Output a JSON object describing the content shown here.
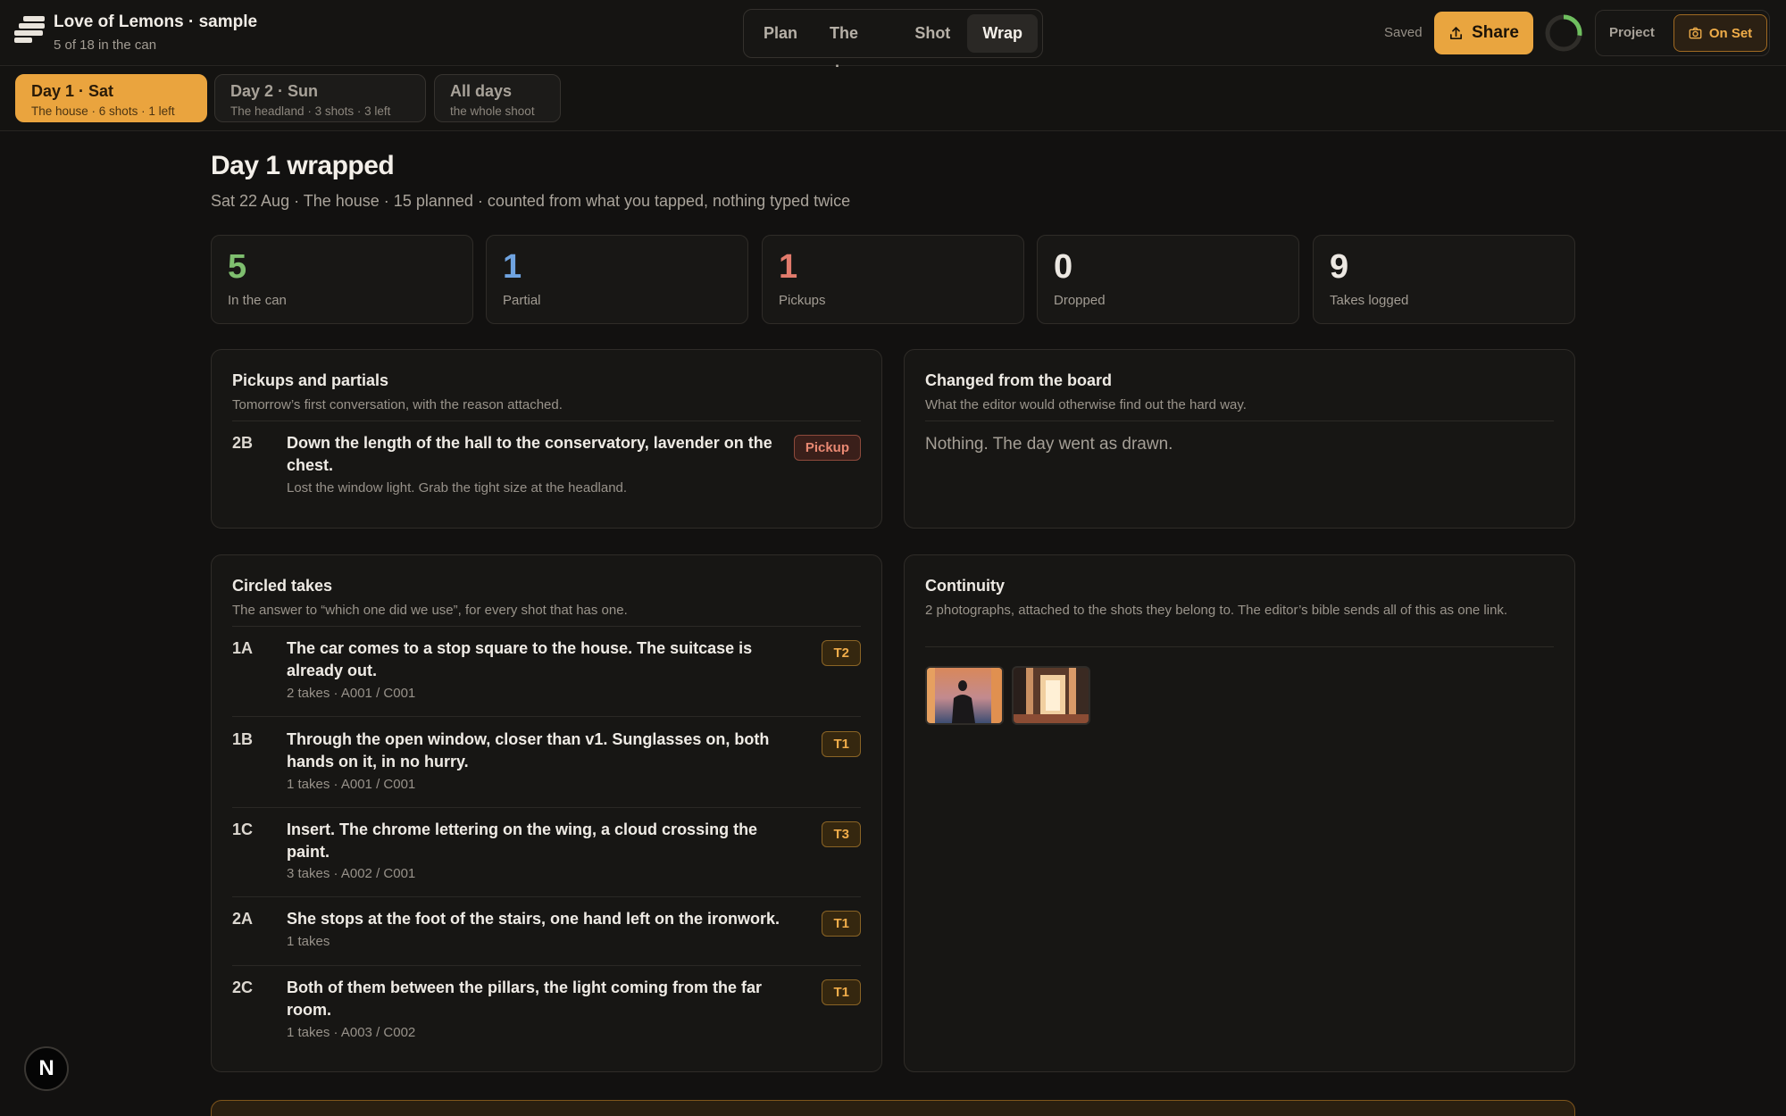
{
  "header": {
    "title": "Love of Lemons · sample",
    "subtitle": "5 of 18 in the can",
    "tabs": [
      {
        "label": "Plan"
      },
      {
        "label": "The day"
      },
      {
        "label": "Shot"
      },
      {
        "label": "Wrap"
      }
    ],
    "active_tab": "Wrap",
    "saved_label": "Saved",
    "share_label": "Share",
    "project_label": "Project",
    "onset_label": "On Set"
  },
  "days": [
    {
      "title": "Day 1 · Sat",
      "sub": "The house · 6 shots · 1 left",
      "active": true
    },
    {
      "title": "Day 2 · Sun",
      "sub": "The headland · 3 shots · 3 left",
      "active": false
    },
    {
      "title": "All days",
      "sub": "the whole shoot",
      "active": false
    }
  ],
  "summary": {
    "title": "Day 1 wrapped",
    "subtitle": "Sat 22 Aug · The house · 15 planned · counted from what you tapped, nothing typed twice"
  },
  "stats": [
    {
      "value": "5",
      "label": "In the can",
      "color": "#7fbf6f"
    },
    {
      "value": "1",
      "label": "Partial",
      "color": "#6fa3e0"
    },
    {
      "value": "1",
      "label": "Pickups",
      "color": "#e27b6c"
    },
    {
      "value": "0",
      "label": "Dropped",
      "color": "#ece8e2"
    },
    {
      "value": "9",
      "label": "Takes logged",
      "color": "#ece8e2"
    }
  ],
  "pickups": {
    "title": "Pickups and partials",
    "subtitle": "Tomorrow’s first conversation, with the reason attached.",
    "items": [
      {
        "code": "2B",
        "text": "Down the length of the hall to the conservatory, lavender on the chest.",
        "note": "Lost the window light. Grab the tight size at the headland.",
        "badge": "Pickup"
      }
    ]
  },
  "changed": {
    "title": "Changed from the board",
    "subtitle": "What the editor would otherwise find out the hard way.",
    "empty": "Nothing. The day went as drawn."
  },
  "circled": {
    "title": "Circled takes",
    "subtitle": "The answer to “which one did we use”, for every shot that has one.",
    "items": [
      {
        "code": "1A",
        "text": "The car comes to a stop square to the house. The suitcase is already out.",
        "meta": "2 takes · A001 / C001",
        "badge": "T2"
      },
      {
        "code": "1B",
        "text": "Through the open window, closer than v1. Sunglasses on, both hands on it, in no hurry.",
        "meta": "1 takes · A001 / C001",
        "badge": "T1"
      },
      {
        "code": "1C",
        "text": "Insert. The chrome lettering on the wing, a cloud crossing the paint.",
        "meta": "3 takes · A002 / C001",
        "badge": "T3"
      },
      {
        "code": "2A",
        "text": "She stops at the foot of the stairs, one hand left on the ironwork.",
        "meta": "1 takes",
        "badge": "T1"
      },
      {
        "code": "2C",
        "text": "Both of them between the pillars, the light coming from the far room.",
        "meta": "1 takes · A003 / C002",
        "badge": "T1"
      }
    ]
  },
  "continuity": {
    "title": "Continuity",
    "subtitle": "2 photographs, attached to the shots they belong to. The editor’s bible sends all of this as one link."
  },
  "fab_label": "N"
}
